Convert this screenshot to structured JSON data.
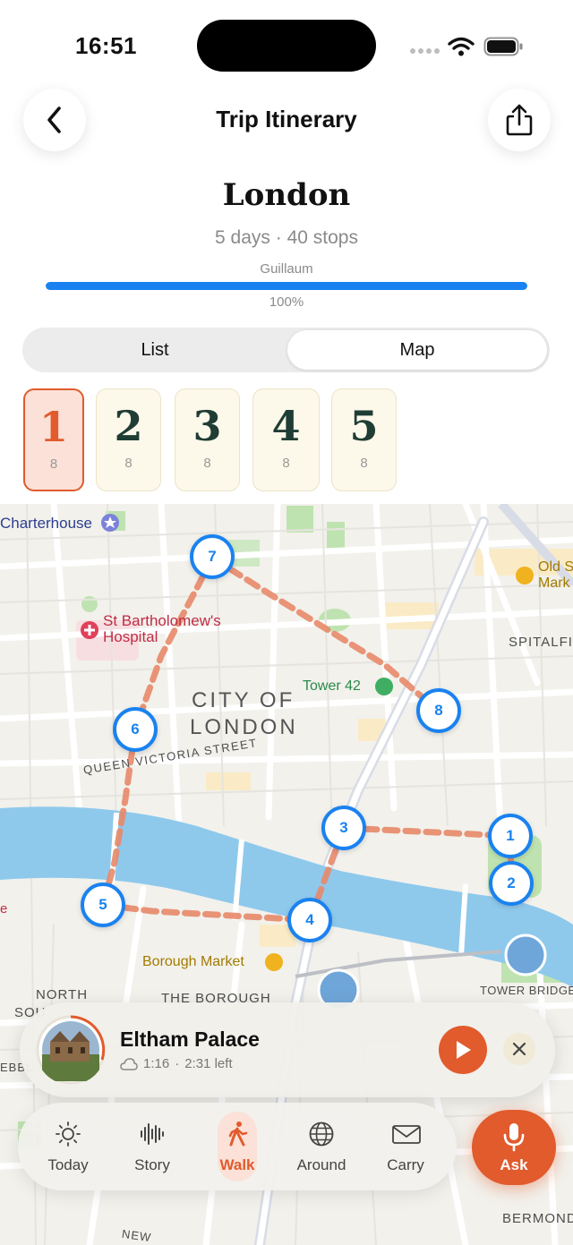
{
  "status_bar": {
    "time": "16:51"
  },
  "header": {
    "title": "Trip Itinerary"
  },
  "trip": {
    "city": "London",
    "meta": "5 days · 40 stops",
    "progress_owner": "Guillaum",
    "progress_value": 1.0,
    "progress_label": "100%"
  },
  "view_toggle": {
    "options": [
      "List",
      "Map"
    ],
    "selected": "Map"
  },
  "days": [
    {
      "number": "1",
      "count": "8"
    },
    {
      "number": "2",
      "count": "8"
    },
    {
      "number": "3",
      "count": "8"
    },
    {
      "number": "4",
      "count": "8"
    },
    {
      "number": "5",
      "count": "8"
    }
  ],
  "selected_day": "1",
  "map": {
    "labels": {
      "charterhouse": "Charterhouse",
      "old_spital": "Old S",
      "old_spital_2": "Mark",
      "st_barts_1": "St Bartholomew's",
      "st_barts_2": "Hospital",
      "spitalfields": "SPITALFI",
      "tower42": "Tower 42",
      "city_of_london_1": "CITY OF",
      "city_of_london_2": "LONDON",
      "queen_victoria": "QUEEN VICTORIA STREET",
      "borough_market": "Borough Market",
      "tower_bridge": "TOWER BRIDGE",
      "north_sou_1": "NORTH",
      "north_sou_2": "SOU",
      "the_borough": "THE BOROUGH",
      "bermond": "BERMOND",
      "ebbl": "EBBL",
      "new": "NEW",
      "e_edge": "e"
    },
    "stops": [
      "1",
      "2",
      "3",
      "4",
      "5",
      "6",
      "7",
      "8"
    ]
  },
  "now_playing": {
    "title": "Eltham Palace",
    "elapsed": "1:16",
    "remaining": "2:31 left",
    "separator": "·"
  },
  "tab_bar": {
    "items": [
      {
        "label": "Today",
        "icon": "sun-icon"
      },
      {
        "label": "Story",
        "icon": "waveform-icon"
      },
      {
        "label": "Walk",
        "icon": "walking-person-icon"
      },
      {
        "label": "Around",
        "icon": "globe-icon"
      },
      {
        "label": "Carry",
        "icon": "envelope-icon"
      }
    ],
    "active": "Walk",
    "ask_label": "Ask"
  },
  "colors": {
    "accent": "#e15b2d",
    "progress": "#1a82f0",
    "marker": "#1a82f0",
    "route": "#e8896a",
    "river": "#8ec9ec"
  }
}
